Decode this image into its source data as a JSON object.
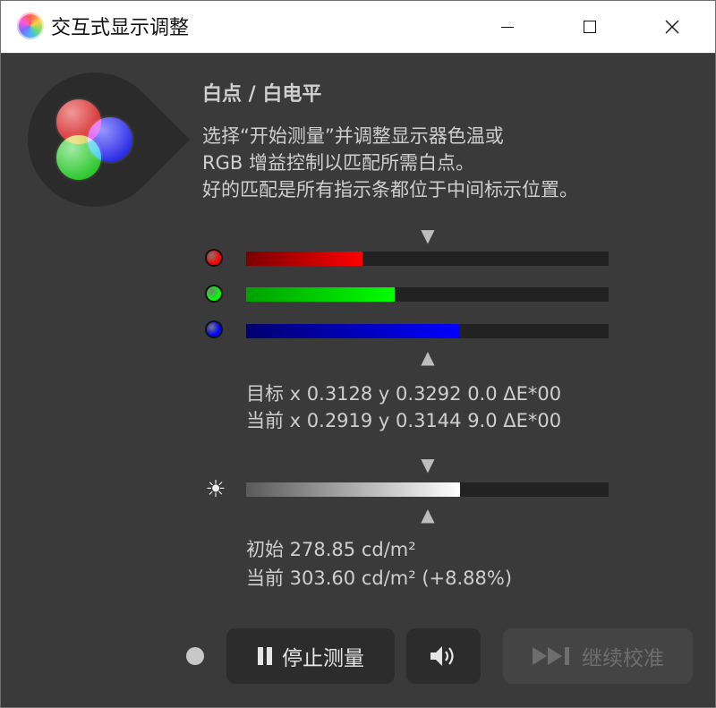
{
  "window": {
    "title": "交互式显示调整",
    "minimize_icon": "minimize-icon",
    "maximize_icon": "maximize-icon",
    "close_icon": "close-icon"
  },
  "logo": {
    "icon": "rgb-circles-icon"
  },
  "heading": "白点 / 白电平",
  "description": [
    "选择“开始测量”并调整显示器色温或",
    "RGB 增益控制以匹配所需白点。",
    "好的匹配是所有指示条都位于中间标示位置。"
  ],
  "rgb_bars": [
    {
      "channel": "red",
      "value": 0.32,
      "dot_color": "#ff0000",
      "fill_from": "#7a0000",
      "fill_to": "#ff0000"
    },
    {
      "channel": "green",
      "value": 0.41,
      "dot_color": "#00ff00",
      "fill_from": "#00a000",
      "fill_to": "#00ff00"
    },
    {
      "channel": "blue",
      "value": 0.59,
      "dot_color": "#0000ff",
      "fill_from": "#000070",
      "fill_to": "#0000ff"
    }
  ],
  "chromaticity": {
    "target": "目标 x 0.3128 y 0.3292 0.0 ΔE*00",
    "current": "当前 x 0.2919 y 0.3144 9.0 ΔE*00"
  },
  "brightness": {
    "icon": "brightness-sun-icon",
    "value": 0.59,
    "initial": "初始 278.85 cd/m²",
    "current": "当前 303.60 cd/m² (+8.88%)"
  },
  "controls": {
    "status_dot_color": "#c8c8c8",
    "stop_label": "停止测量",
    "stop_icon": "pause-icon",
    "sound_icon": "speaker-icon",
    "continue_label": "继续校准",
    "continue_icon": "skip-forward-icon"
  },
  "colors": {
    "background": "#3a3a3a",
    "track": "#222222",
    "button": "#2c2c2c",
    "button_disabled": "#444444",
    "text": "#cfcfcf"
  }
}
